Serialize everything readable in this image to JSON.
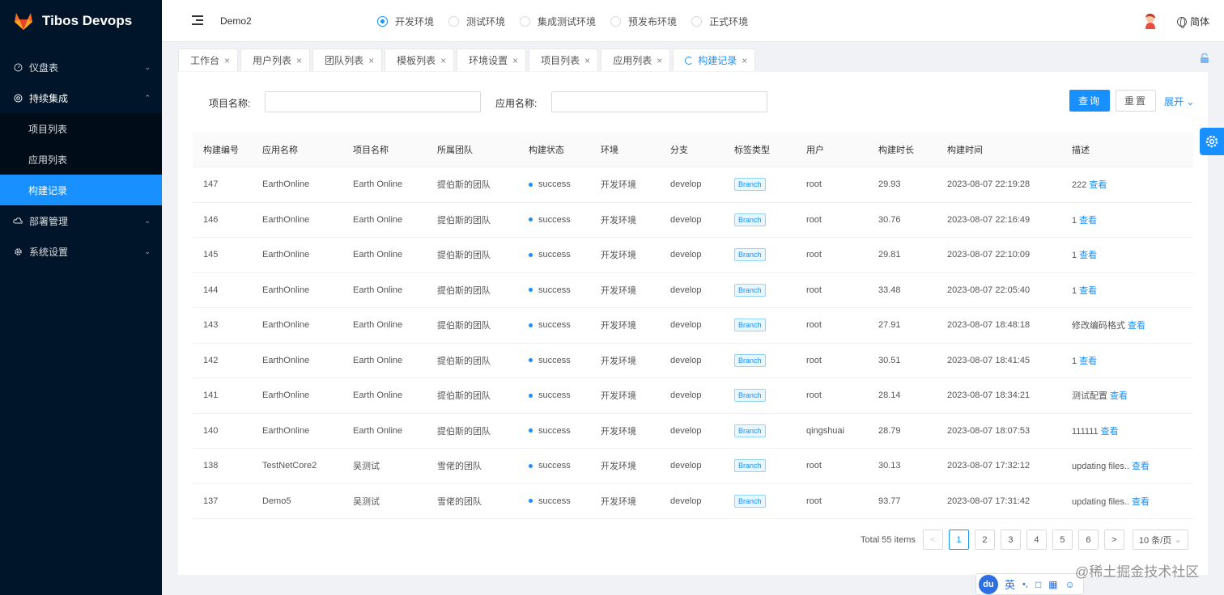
{
  "app": {
    "title": "Tibos Devops"
  },
  "sidebar": {
    "items": [
      {
        "label": "仪盘表",
        "icon": "dashboard-icon",
        "arrow": "down"
      },
      {
        "label": "持续集成",
        "icon": "integration-icon",
        "arrow": "up",
        "children": [
          {
            "label": "项目列表",
            "active": false
          },
          {
            "label": "应用列表",
            "active": false
          },
          {
            "label": "构建记录",
            "active": true
          }
        ]
      },
      {
        "label": "部署管理",
        "icon": "cloud-icon",
        "arrow": "down"
      },
      {
        "label": "系统设置",
        "icon": "gear-icon",
        "arrow": "down"
      }
    ]
  },
  "header": {
    "breadcrumb": "Demo2",
    "envs": [
      {
        "label": "开发环境",
        "checked": true
      },
      {
        "label": "测试环境",
        "checked": false
      },
      {
        "label": "集成测试环境",
        "checked": false
      },
      {
        "label": "预发布环境",
        "checked": false
      },
      {
        "label": "正式环境",
        "checked": false
      }
    ],
    "language": "简体"
  },
  "tabs": [
    {
      "label": "工作台",
      "active": false
    },
    {
      "label": "用户列表",
      "active": false
    },
    {
      "label": "团队列表",
      "active": false
    },
    {
      "label": "模板列表",
      "active": false
    },
    {
      "label": "环境设置",
      "active": false
    },
    {
      "label": "项目列表",
      "active": false
    },
    {
      "label": "应用列表",
      "active": false
    },
    {
      "label": "构建记录",
      "active": true
    }
  ],
  "filter": {
    "project_label": "项目名称:",
    "project_value": "",
    "app_label": "应用名称:",
    "app_value": "",
    "query_button": "查询",
    "reset_button": "重置",
    "expand_label": "展开"
  },
  "table": {
    "columns": [
      "构建编号",
      "应用名称",
      "项目名称",
      "所属团队",
      "构建状态",
      "环境",
      "分支",
      "标签类型",
      "用户",
      "构建时长",
      "构建时间",
      "描述"
    ],
    "action_label": "查看",
    "rows": [
      {
        "id": "147",
        "app": "EarthOnline",
        "project": "Earth Online",
        "team": "提伯斯的团队",
        "status": "success",
        "env": "开发环境",
        "branch": "develop",
        "tag": "Branch",
        "user": "root",
        "duration": "29.93",
        "time": "2023-08-07 22:19:28",
        "desc": "222"
      },
      {
        "id": "146",
        "app": "EarthOnline",
        "project": "Earth Online",
        "team": "提伯斯的团队",
        "status": "success",
        "env": "开发环境",
        "branch": "develop",
        "tag": "Branch",
        "user": "root",
        "duration": "30.76",
        "time": "2023-08-07 22:16:49",
        "desc": "1"
      },
      {
        "id": "145",
        "app": "EarthOnline",
        "project": "Earth Online",
        "team": "提伯斯的团队",
        "status": "success",
        "env": "开发环境",
        "branch": "develop",
        "tag": "Branch",
        "user": "root",
        "duration": "29.81",
        "time": "2023-08-07 22:10:09",
        "desc": "1"
      },
      {
        "id": "144",
        "app": "EarthOnline",
        "project": "Earth Online",
        "team": "提伯斯的团队",
        "status": "success",
        "env": "开发环境",
        "branch": "develop",
        "tag": "Branch",
        "user": "root",
        "duration": "33.48",
        "time": "2023-08-07 22:05:40",
        "desc": "1"
      },
      {
        "id": "143",
        "app": "EarthOnline",
        "project": "Earth Online",
        "team": "提伯斯的团队",
        "status": "success",
        "env": "开发环境",
        "branch": "develop",
        "tag": "Branch",
        "user": "root",
        "duration": "27.91",
        "time": "2023-08-07 18:48:18",
        "desc": "修改编码格式"
      },
      {
        "id": "142",
        "app": "EarthOnline",
        "project": "Earth Online",
        "team": "提伯斯的团队",
        "status": "success",
        "env": "开发环境",
        "branch": "develop",
        "tag": "Branch",
        "user": "root",
        "duration": "30.51",
        "time": "2023-08-07 18:41:45",
        "desc": "1"
      },
      {
        "id": "141",
        "app": "EarthOnline",
        "project": "Earth Online",
        "team": "提伯斯的团队",
        "status": "success",
        "env": "开发环境",
        "branch": "develop",
        "tag": "Branch",
        "user": "root",
        "duration": "28.14",
        "time": "2023-08-07 18:34:21",
        "desc": "测试配置"
      },
      {
        "id": "140",
        "app": "EarthOnline",
        "project": "Earth Online",
        "team": "提伯斯的团队",
        "status": "success",
        "env": "开发环境",
        "branch": "develop",
        "tag": "Branch",
        "user": "qingshuai",
        "duration": "28.79",
        "time": "2023-08-07 18:07:53",
        "desc": "111111"
      },
      {
        "id": "138",
        "app": "TestNetCore2",
        "project": "吴测试",
        "team": "雪佬的团队",
        "status": "success",
        "env": "开发环境",
        "branch": "develop",
        "tag": "Branch",
        "user": "root",
        "duration": "30.13",
        "time": "2023-08-07 17:32:12",
        "desc": "updating files.."
      },
      {
        "id": "137",
        "app": "Demo5",
        "project": "吴测试",
        "team": "雪佬的团队",
        "status": "success",
        "env": "开发环境",
        "branch": "develop",
        "tag": "Branch",
        "user": "root",
        "duration": "93.77",
        "time": "2023-08-07 17:31:42",
        "desc": "updating files.."
      }
    ]
  },
  "pagination": {
    "total": "Total 55 items",
    "prev": "<",
    "next": ">",
    "pages": [
      "1",
      "2",
      "3",
      "4",
      "5",
      "6"
    ],
    "current": "1",
    "page_size": "10 条/页"
  },
  "ime": {
    "logo": "du",
    "mode": "英"
  },
  "watermark": "@稀土掘金技术社区",
  "colors": {
    "sidebar_bg": "#001529",
    "accent": "#1890ff",
    "panel_bg": "#ffffff",
    "page_bg": "#f0f2f5"
  }
}
